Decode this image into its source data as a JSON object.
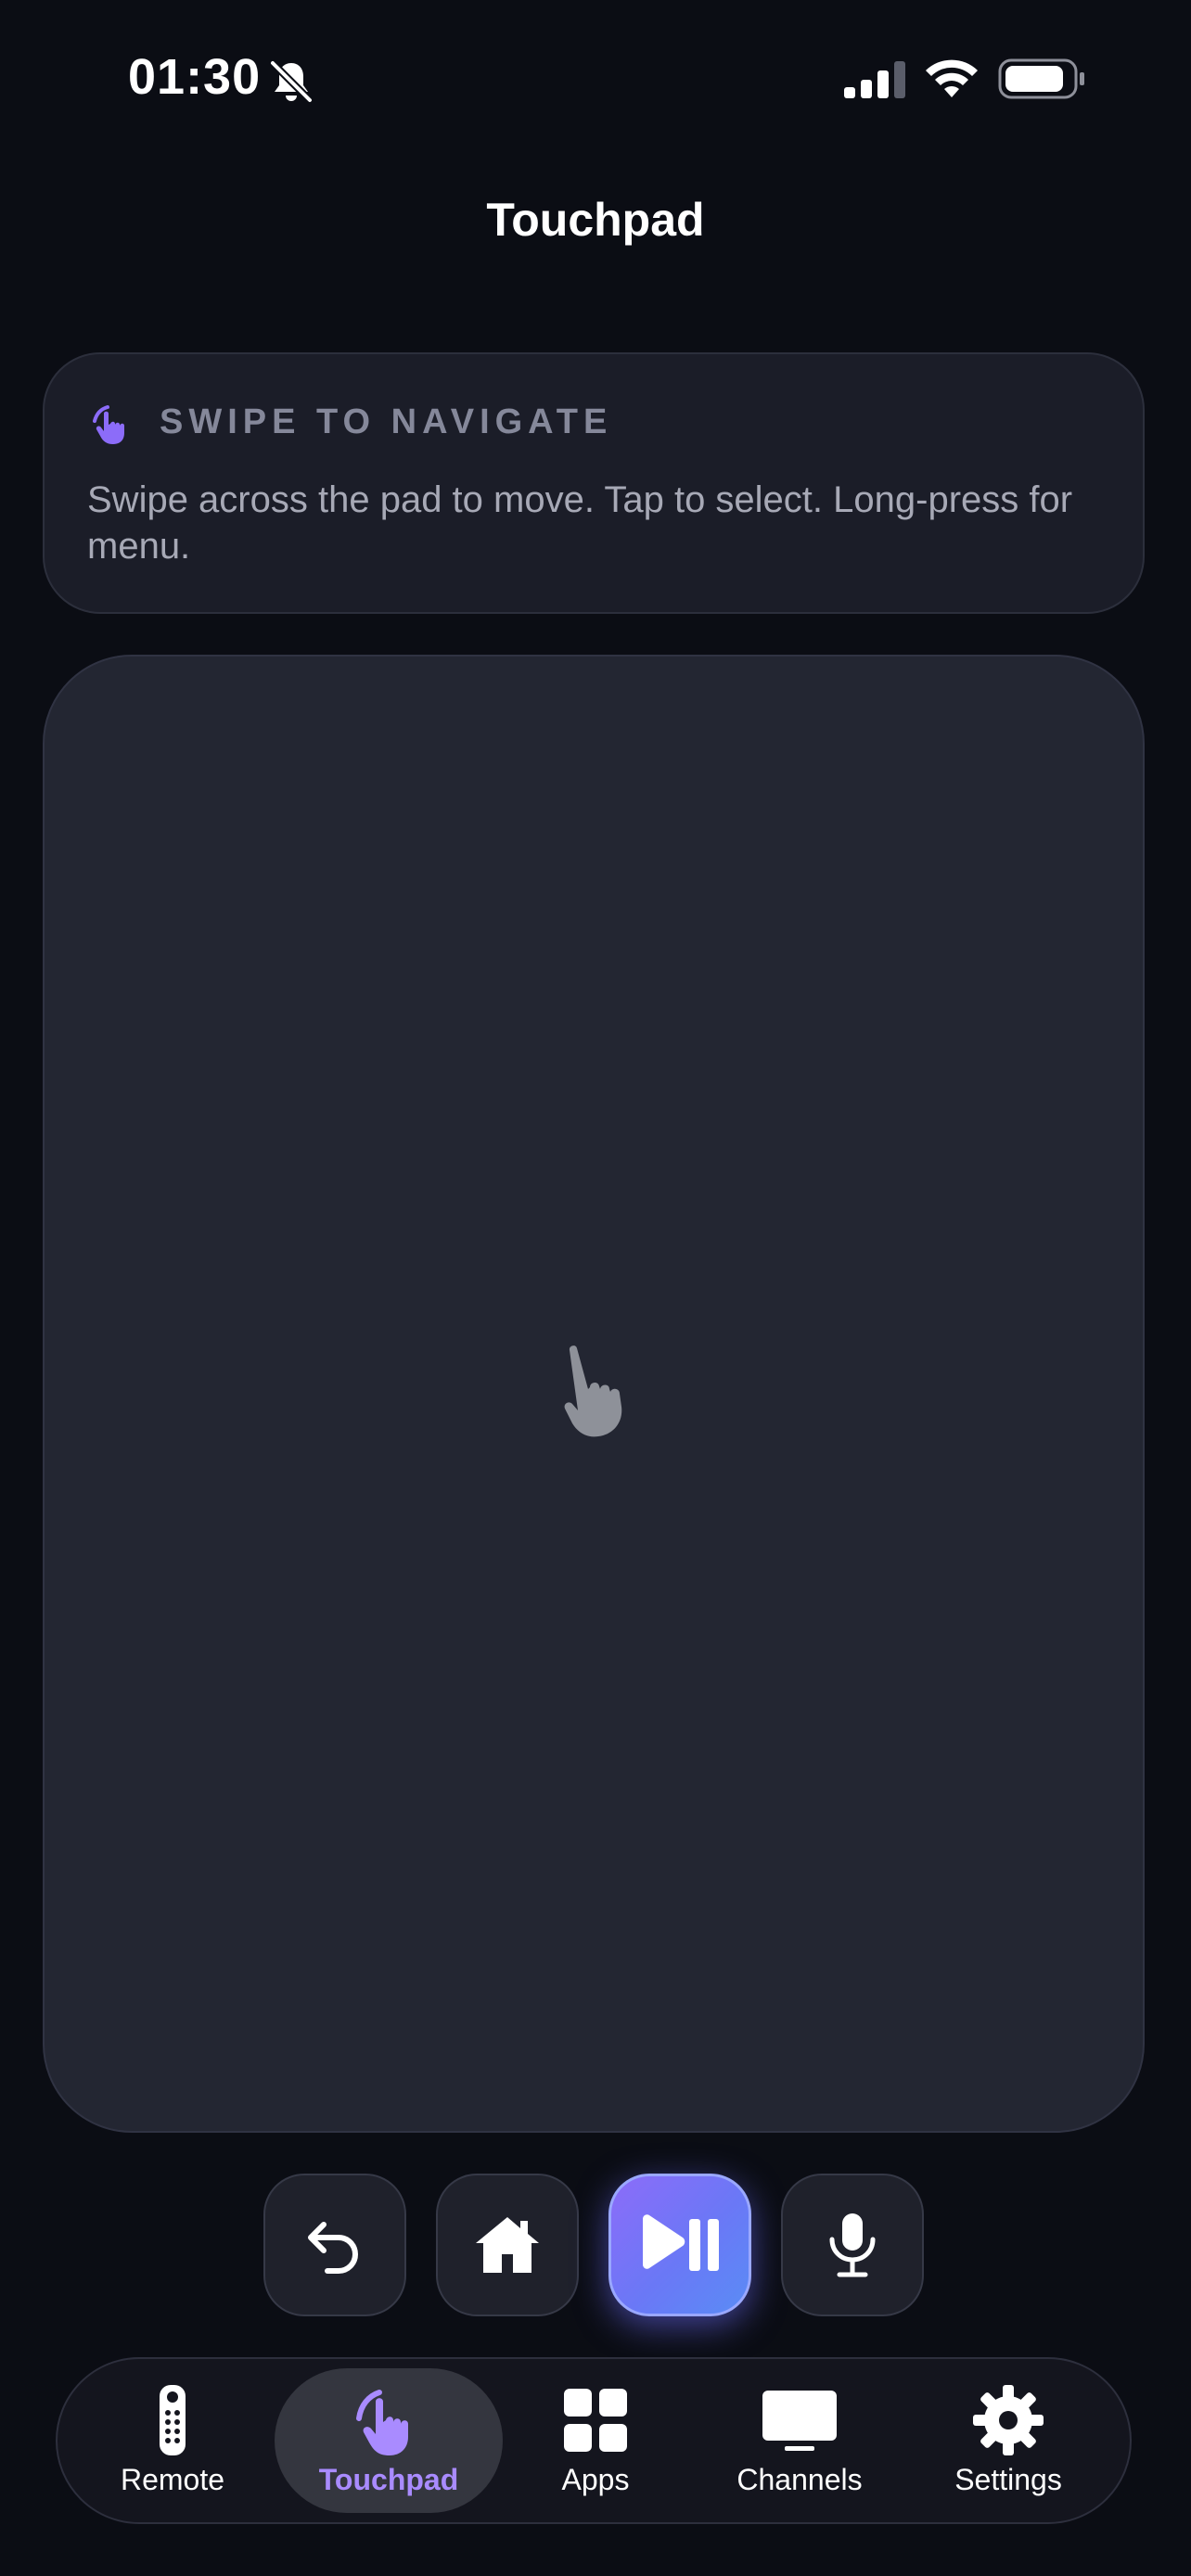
{
  "status_bar": {
    "time": "01:30"
  },
  "header": {
    "title": "Touchpad"
  },
  "info_card": {
    "heading": "SWIPE TO NAVIGATE",
    "body": "Swipe across the pad to move. Tap to select. Long-press for menu."
  },
  "controls": [
    {
      "icon": "back-arrow-icon"
    },
    {
      "icon": "home-icon"
    },
    {
      "icon": "play-pause-icon"
    },
    {
      "icon": "microphone-icon"
    }
  ],
  "tab_bar": {
    "active": "Touchpad",
    "items": [
      {
        "label": "Remote",
        "icon": "remote-icon"
      },
      {
        "label": "Touchpad",
        "icon": "hand-swipe-icon"
      },
      {
        "label": "Apps",
        "icon": "grid-icon"
      },
      {
        "label": "Channels",
        "icon": "tv-icon"
      },
      {
        "label": "Settings",
        "icon": "gear-icon"
      }
    ]
  },
  "colors": {
    "background": "#0b0d14",
    "card": "#1b1d28",
    "touchpad": "#232632",
    "accent": "#8c6cf9",
    "accent_label": "#a98bff",
    "muted_text": "#85889a"
  }
}
